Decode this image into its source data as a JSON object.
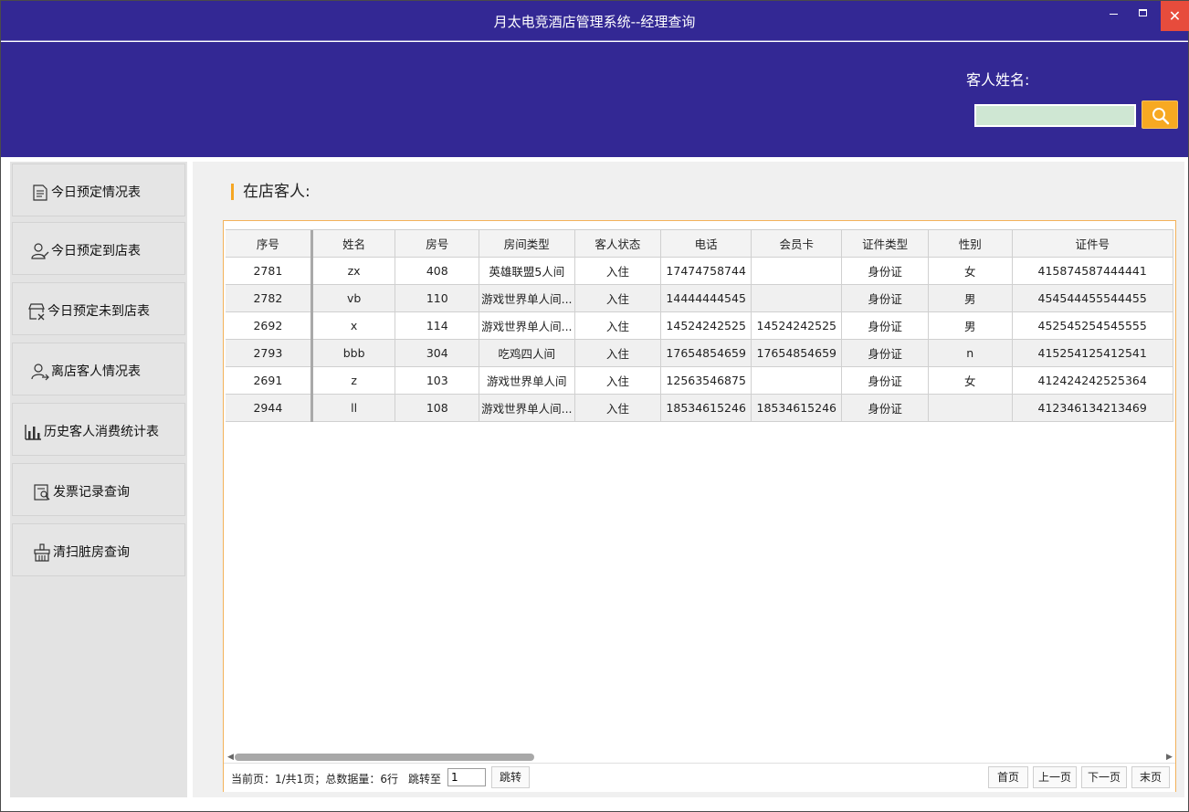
{
  "window": {
    "title": "月太电竞酒店管理系统--经理查询"
  },
  "header": {
    "search_label": "客人姓名:",
    "search_value": ""
  },
  "sidebar": {
    "items": [
      {
        "label": "今日预定情况表",
        "icon": "document-icon"
      },
      {
        "label": "今日预定到店表",
        "icon": "user-check-icon"
      },
      {
        "label": "今日预定未到店表",
        "icon": "store-cancel-icon"
      },
      {
        "label": "离店客人情况表",
        "icon": "user-leave-icon"
      },
      {
        "label": "历史客人消费统计表",
        "icon": "bar-chart-icon"
      },
      {
        "label": "发票记录查询",
        "icon": "invoice-search-icon"
      },
      {
        "label": "清扫脏房查询",
        "icon": "cleaning-icon"
      }
    ]
  },
  "main": {
    "section_title": "在店客人:",
    "table": {
      "columns": [
        "序号",
        "姓名",
        "房号",
        "房间类型",
        "客人状态",
        "电话",
        "会员卡",
        "证件类型",
        "性别",
        "证件号"
      ],
      "rows": [
        [
          "2781",
          "zx",
          "408",
          "英雄联盟5人间",
          "入住",
          "17474758744",
          "",
          "身份证",
          "女",
          "415874587444441"
        ],
        [
          "2782",
          "vb",
          "110",
          "游戏世界单人间...",
          "入住",
          "14444444545",
          "",
          "身份证",
          "男",
          "454544455544455"
        ],
        [
          "2692",
          "x",
          "114",
          "游戏世界单人间...",
          "入住",
          "14524242525",
          "14524242525",
          "身份证",
          "男",
          "452545254545555"
        ],
        [
          "2793",
          "bbb",
          "304",
          "吃鸡四人间",
          "入住",
          "17654854659",
          "17654854659",
          "身份证",
          "n",
          "415254125412541"
        ],
        [
          "2691",
          "z",
          "103",
          "游戏世界单人间",
          "入住",
          "12563546875",
          "",
          "身份证",
          "女",
          "412424242525364"
        ],
        [
          "2944",
          "ll",
          "108",
          "游戏世界单人间...",
          "入住",
          "18534615246",
          "18534615246",
          "身份证",
          "",
          "412346134213469"
        ]
      ]
    },
    "pager": {
      "info": "当前页：1/共1页；总数据量：6行",
      "jump_label": "跳转至",
      "jump_value": "1",
      "jump_button": "跳转",
      "first": "首页",
      "prev": "上一页",
      "next": "下一页",
      "last": "末页"
    }
  }
}
